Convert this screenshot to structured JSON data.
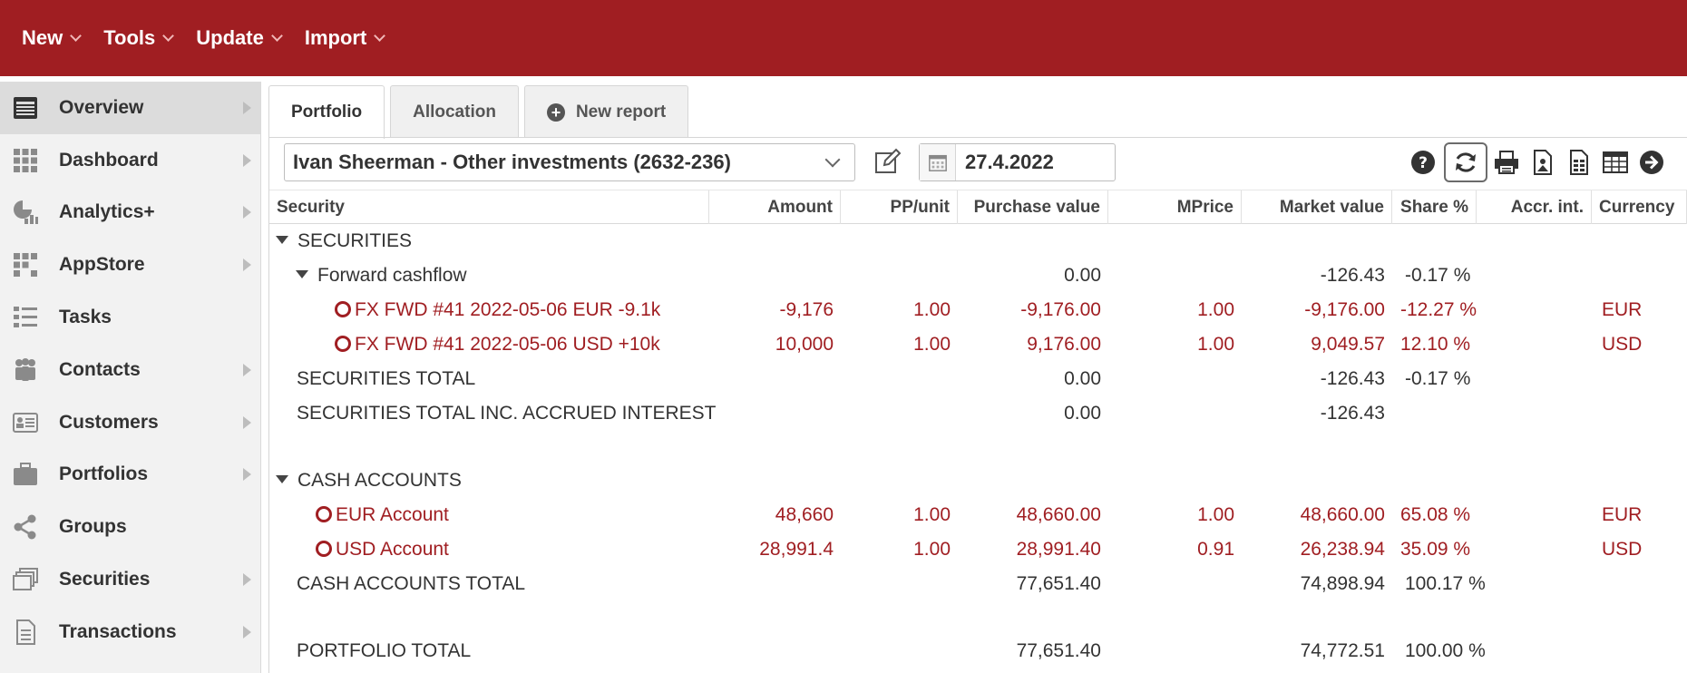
{
  "topbar": {
    "menus": [
      "New",
      "Tools",
      "Update",
      "Import"
    ]
  },
  "sidebar": {
    "items": [
      {
        "label": "Overview",
        "icon": "overview-icon",
        "arrow": true,
        "active": true
      },
      {
        "label": "Dashboard",
        "icon": "dashboard-icon",
        "arrow": true
      },
      {
        "label": "Analytics+",
        "icon": "analytics-icon",
        "arrow": true
      },
      {
        "label": "AppStore",
        "icon": "appstore-icon",
        "arrow": true
      },
      {
        "label": "Tasks",
        "icon": "tasks-icon",
        "arrow": false
      },
      {
        "label": "Contacts",
        "icon": "contacts-icon",
        "arrow": true
      },
      {
        "label": "Customers",
        "icon": "customers-icon",
        "arrow": true
      },
      {
        "label": "Portfolios",
        "icon": "portfolios-icon",
        "arrow": true
      },
      {
        "label": "Groups",
        "icon": "groups-icon",
        "arrow": false
      },
      {
        "label": "Securities",
        "icon": "securities-icon",
        "arrow": true
      },
      {
        "label": "Transactions",
        "icon": "transactions-icon",
        "arrow": true
      }
    ]
  },
  "tabs": {
    "portfolio": "Portfolio",
    "allocation": "Allocation",
    "new_report": "New report"
  },
  "toolbar": {
    "portfolio_name": "Ivan Sheerman - Other investments (2632-236)",
    "date": "27.4.2022",
    "icons": [
      "help-icon",
      "refresh-icon",
      "print-icon",
      "pdf-icon",
      "excel-icon",
      "table-icon",
      "go-icon"
    ]
  },
  "colors": {
    "brand": "#a01e22",
    "negative_text": "#a01e22"
  },
  "table": {
    "columns": [
      "Security",
      "Amount",
      "PP/unit",
      "Purchase value",
      "MPrice",
      "Market value",
      "Share %",
      "Accr. int.",
      "Currency"
    ],
    "rows": [
      {
        "type": "group",
        "label": "SECURITIES",
        "purchase": "",
        "market": "",
        "share": ""
      },
      {
        "type": "subgroup",
        "label": "Forward cashflow",
        "purchase": "0.00",
        "market": "-126.43",
        "share": "-0.17 %"
      },
      {
        "type": "item",
        "label": "FX FWD #41 2022-05-06 EUR -9.1k",
        "amount": "-9,176",
        "pp": "1.00",
        "purchase": "-9,176.00",
        "mprice": "1.00",
        "market": "-9,176.00",
        "share": "-12.27 %",
        "currency": "EUR"
      },
      {
        "type": "item",
        "label": "FX FWD #41 2022-05-06 USD +10k",
        "amount": "10,000",
        "pp": "1.00",
        "purchase": "9,176.00",
        "mprice": "1.00",
        "market": "9,049.57",
        "share": "12.10 %",
        "currency": "USD"
      },
      {
        "type": "total",
        "label": "SECURITIES TOTAL",
        "purchase": "0.00",
        "market": "-126.43",
        "share": "-0.17 %"
      },
      {
        "type": "total",
        "label": "SECURITIES TOTAL INC. ACCRUED INTEREST",
        "purchase": "0.00",
        "market": "-126.43",
        "share": ""
      },
      {
        "type": "spacer"
      },
      {
        "type": "group",
        "label": "CASH ACCOUNTS",
        "purchase": "",
        "market": "",
        "share": ""
      },
      {
        "type": "account",
        "label": "EUR Account",
        "amount": "48,660",
        "pp": "1.00",
        "purchase": "48,660.00",
        "mprice": "1.00",
        "market": "48,660.00",
        "share": "65.08 %",
        "currency": "EUR"
      },
      {
        "type": "account",
        "label": "USD Account",
        "amount": "28,991.4",
        "pp": "1.00",
        "purchase": "28,991.40",
        "mprice": "0.91",
        "market": "26,238.94",
        "share": "35.09 %",
        "currency": "USD"
      },
      {
        "type": "total",
        "label": "CASH ACCOUNTS TOTAL",
        "purchase": "77,651.40",
        "market": "74,898.94",
        "share": "100.17 %"
      },
      {
        "type": "spacer"
      },
      {
        "type": "total",
        "label": "PORTFOLIO TOTAL",
        "purchase": "77,651.40",
        "market": "74,772.51",
        "share": "100.00 %"
      }
    ]
  }
}
